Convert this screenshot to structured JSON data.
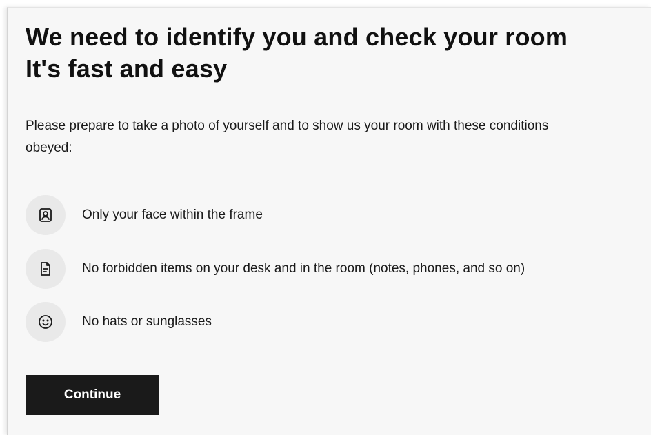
{
  "header": {
    "title_line1": "We need to identify you and check your room",
    "title_line2": "It's fast and easy"
  },
  "intro": {
    "text": "Please prepare to take a photo of yourself and to show us your room with these conditions obeyed:"
  },
  "conditions": [
    {
      "icon": "portrait-frame-icon",
      "text": "Only your face within the frame"
    },
    {
      "icon": "document-icon",
      "text": "No forbidden items on your desk and in the room (notes, phones, and so on)"
    },
    {
      "icon": "smiley-face-icon",
      "text": "No hats or sunglasses"
    }
  ],
  "actions": {
    "continue_label": "Continue"
  },
  "colors": {
    "page_background": "#f7f7f7",
    "text": "#1a1a1a",
    "icon_circle": "#e9e9e9",
    "button_background": "#1a1a1a",
    "button_text": "#ffffff"
  }
}
